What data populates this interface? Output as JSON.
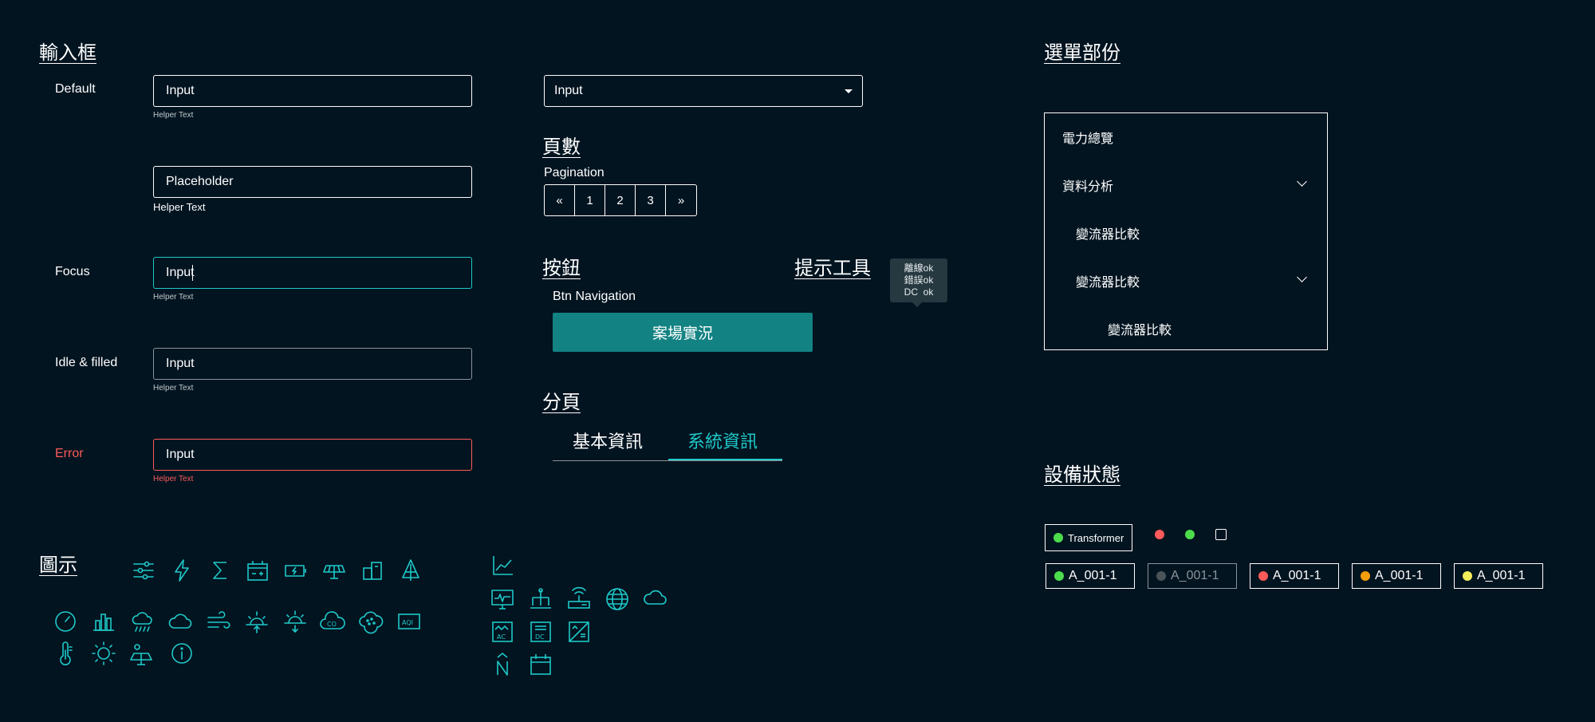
{
  "sections": {
    "input_box": "輸入框",
    "pages": "頁數",
    "button": "按鈕",
    "tooltip_tool": "提示工具",
    "tabs": "分頁",
    "menu": "選單部份",
    "icons": "圖示",
    "device_status": "設備狀態"
  },
  "inputs": {
    "default": {
      "label": "Default",
      "value": "Input",
      "helper": "Helper Text"
    },
    "placeholder": {
      "placeholder": "Placeholder",
      "helper": "Helper Text"
    },
    "focus": {
      "label": "Focus",
      "value": "Input",
      "helper": "Helper Text"
    },
    "idle": {
      "label": "Idle & filled",
      "value": "Input",
      "helper": "Helper Text"
    },
    "error": {
      "label": "Error",
      "value": "Input",
      "helper": "Helper Text"
    }
  },
  "select": {
    "value": "Input"
  },
  "pagination": {
    "label": "Pagination",
    "items": [
      "«",
      "1",
      "2",
      "3",
      "»"
    ]
  },
  "button_nav": {
    "label": "Btn Navigation",
    "button": "案場實況"
  },
  "tooltip": {
    "lines": [
      "離線ok",
      "錯誤ok",
      "DC  ok"
    ]
  },
  "tabs": {
    "items": [
      "基本資訊",
      "系統資訊"
    ],
    "active": 1
  },
  "menu": {
    "items": [
      {
        "label": "電力總覽"
      },
      {
        "label": "資料分析"
      },
      {
        "label": "變流器比較"
      },
      {
        "label": "變流器比較"
      },
      {
        "label": "變流器比較"
      }
    ]
  },
  "status": {
    "transformer": "Transformer",
    "chips": [
      {
        "label": "A_001-1",
        "color": "#4cdc4c"
      },
      {
        "label": "A_001-1",
        "color": "#4a5358"
      },
      {
        "label": "A_001-1",
        "color": "#ff5a5a"
      },
      {
        "label": "A_001-1",
        "color": "#f59e0b"
      },
      {
        "label": "A_001-1",
        "color": "#f5ee5a"
      }
    ]
  },
  "colors": {
    "accent": "#1fc9c9",
    "error": "#ff5a5a",
    "button": "#138282",
    "background": "#021420"
  }
}
